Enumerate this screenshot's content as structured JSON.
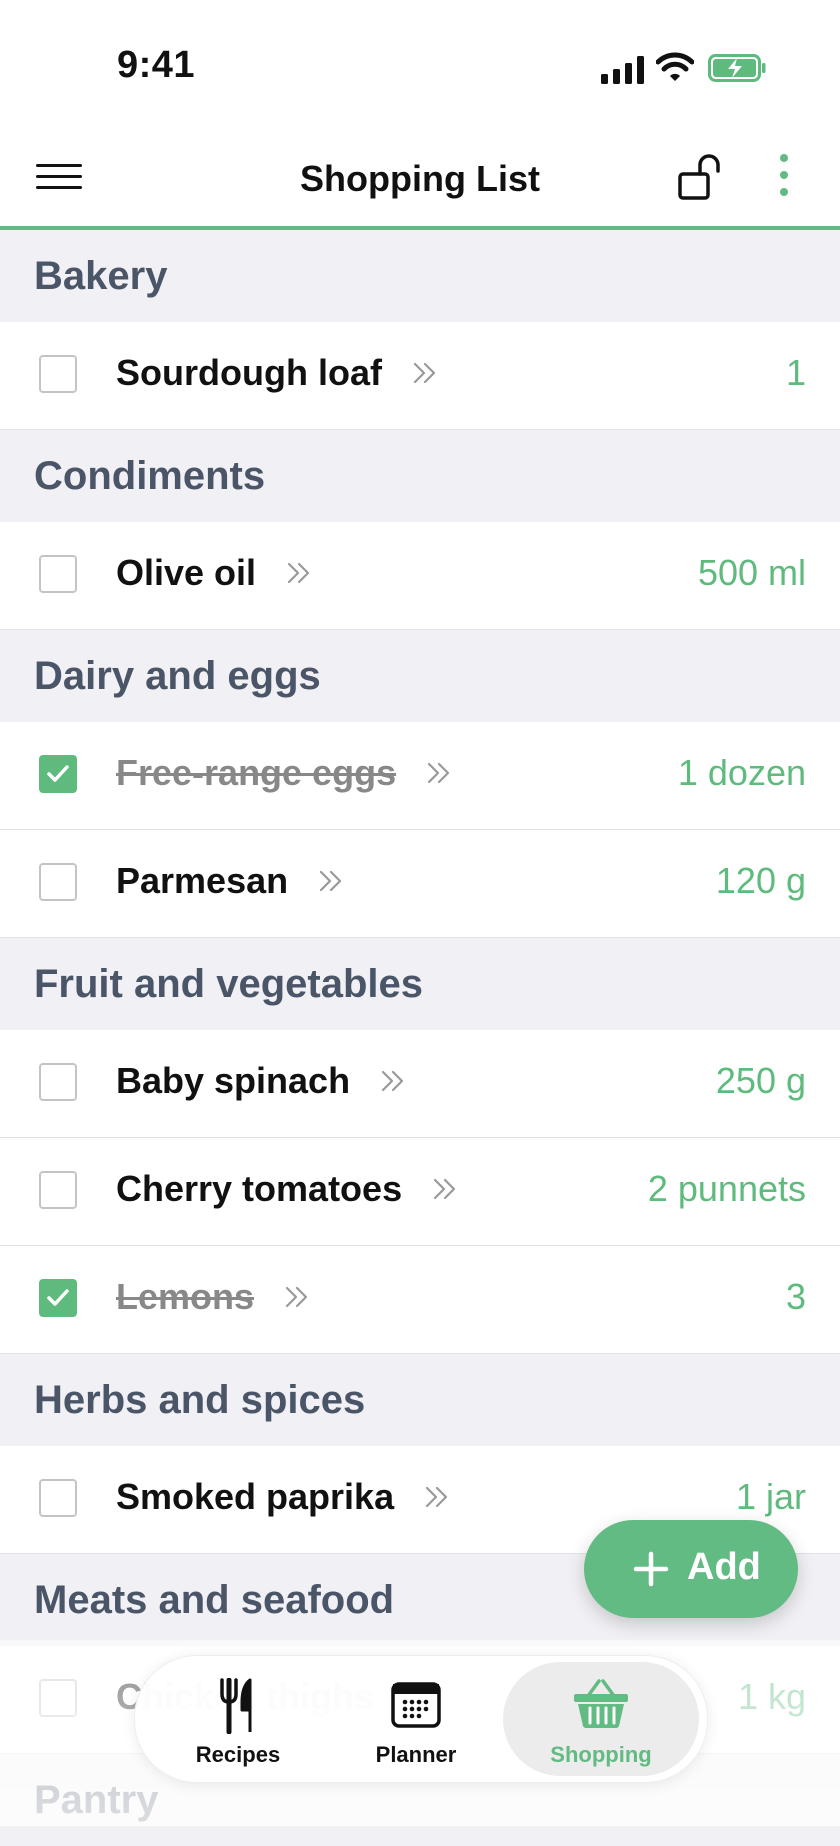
{
  "status_bar": {
    "time": "9:41"
  },
  "header": {
    "title": "Shopping List"
  },
  "sections": [
    {
      "name": "Bakery",
      "items": [
        {
          "name": "Sourdough loaf",
          "qty": "1",
          "checked": false
        }
      ]
    },
    {
      "name": "Condiments",
      "items": [
        {
          "name": "Olive oil",
          "qty": "500 ml",
          "checked": false
        }
      ]
    },
    {
      "name": "Dairy and eggs",
      "items": [
        {
          "name": "Free-range eggs",
          "qty": "1 dozen",
          "checked": true
        },
        {
          "name": "Parmesan",
          "qty": "120 g",
          "checked": false
        }
      ]
    },
    {
      "name": "Fruit and vegetables",
      "items": [
        {
          "name": "Baby spinach",
          "qty": "250 g",
          "checked": false
        },
        {
          "name": "Cherry tomatoes",
          "qty": "2 punnets",
          "checked": false
        },
        {
          "name": "Lemons",
          "qty": "3",
          "checked": true
        }
      ]
    },
    {
      "name": "Herbs and spices",
      "items": [
        {
          "name": "Smoked paprika",
          "qty": "1 jar",
          "checked": false
        }
      ]
    },
    {
      "name": "Meats and seafood",
      "items": [
        {
          "name": "Chicken thighs",
          "qty": "1 kg",
          "checked": false
        }
      ]
    },
    {
      "name": "Pantry",
      "items": []
    }
  ],
  "fab": {
    "label": "Add"
  },
  "tabbar": {
    "tabs": [
      {
        "label": "Recipes",
        "icon": "fork-knife-icon",
        "active": false
      },
      {
        "label": "Planner",
        "icon": "calendar-icon",
        "active": false
      },
      {
        "label": "Shopping",
        "icon": "basket-icon",
        "active": true
      }
    ]
  },
  "colors": {
    "accent": "#62bb82",
    "section_bg": "#f1f1f5",
    "section_text": "#4a5568"
  }
}
